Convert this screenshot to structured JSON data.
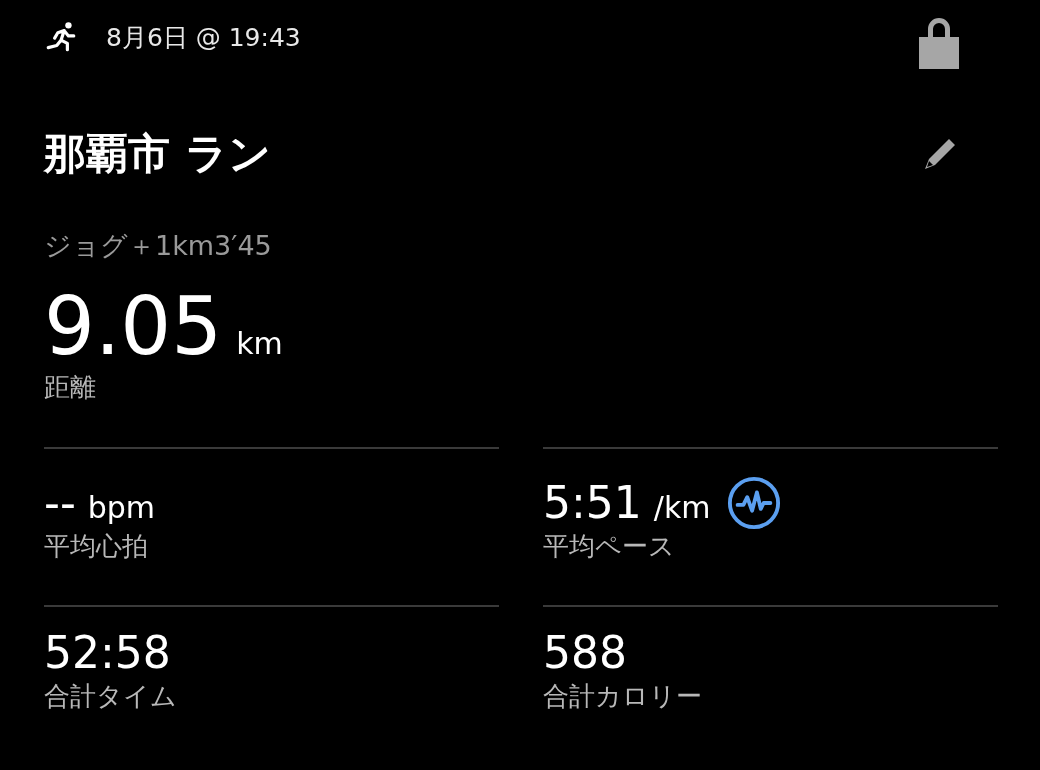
{
  "header": {
    "datetime": "8月6日 @ 19:43"
  },
  "activity": {
    "title": "那覇市 ラン",
    "description": "ジョグ＋1km3′45",
    "distance": {
      "value": "9.05",
      "unit": "km",
      "label": "距離"
    }
  },
  "stats": [
    {
      "kind": "plain",
      "value": "--",
      "unit": "bpm",
      "label": "平均心拍"
    },
    {
      "kind": "graph",
      "value": "5:51",
      "unit": "/km",
      "label": "平均ペース"
    },
    {
      "kind": "plain",
      "value": "52:58",
      "label": "合計タイム"
    },
    {
      "kind": "plain",
      "value": "588",
      "label": "合計カロリー"
    }
  ]
}
